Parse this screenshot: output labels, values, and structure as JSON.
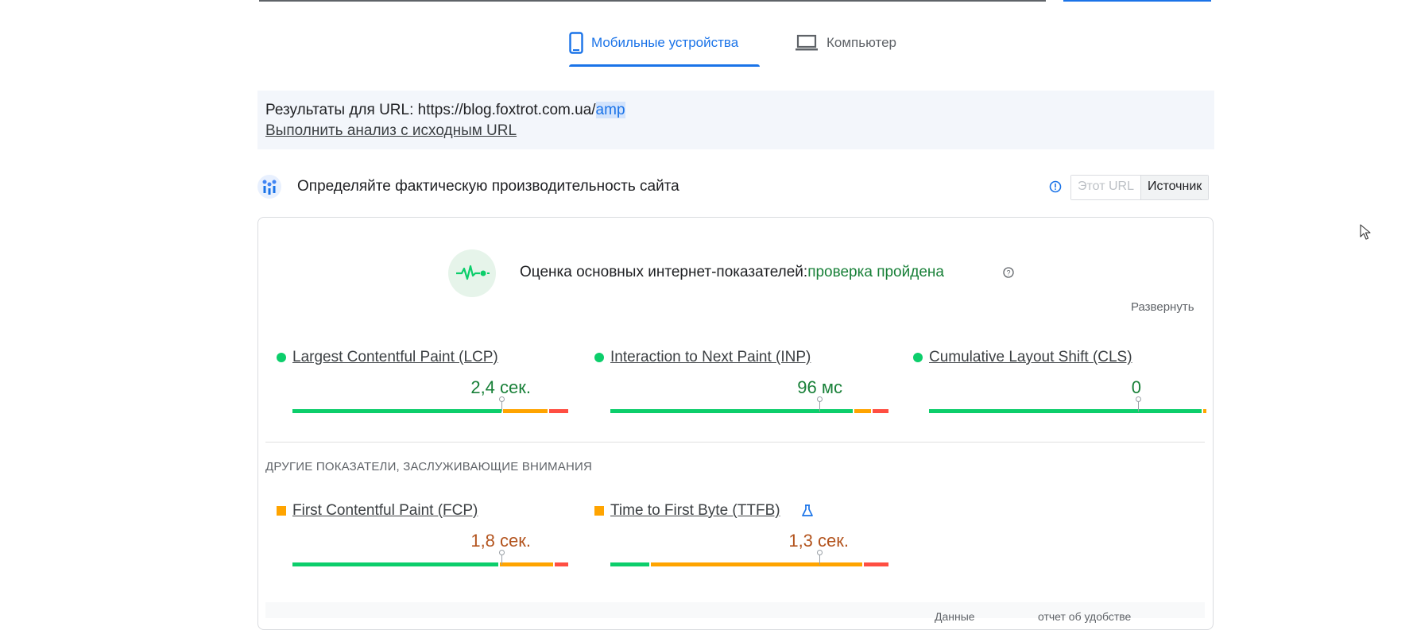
{
  "tabs": {
    "mobile_label": "Мобильные устройства",
    "desktop_label": "Компьютер"
  },
  "url_banner": {
    "prefix": "Результаты для URL: https://blog.foxtrot.com.ua/",
    "highlight": "amp",
    "reanalyze": "Выполнить анализ с исходным URL"
  },
  "section": {
    "title": "Определяйте фактическую производительность сайта",
    "toggle_this_url": "Этот URL",
    "toggle_origin": "Источник"
  },
  "cwv": {
    "title": "Оценка основных интернет-показателей:",
    "status": "проверка пройдена",
    "expand": "Развернуть"
  },
  "metrics": [
    {
      "label": "Largest Contentful Paint (LCP)",
      "value": "2,4 сек.",
      "rating": "good",
      "distribution": {
        "good": 0.75,
        "needs_improvement": 0.16,
        "poor": 0.07
      },
      "marker": 0.75
    },
    {
      "label": "Interaction to Next Paint (INP)",
      "value": "96 мс",
      "rating": "good",
      "distribution": {
        "good": 0.87,
        "needs_improvement": 0.06,
        "poor": 0.07
      },
      "marker": 0.75
    },
    {
      "label": "Cumulative Layout Shift (CLS)",
      "value": "0",
      "rating": "good",
      "distribution": {
        "good": 0.98,
        "needs_improvement": 0.01,
        "poor": 0.01
      },
      "marker": 0.75
    }
  ],
  "other_title": "ДРУГИЕ ПОКАЗАТЕЛИ, ЗАСЛУЖИВАЮЩИЕ ВНИМАНИЯ",
  "other_metrics": [
    {
      "label": "First Contentful Paint (FCP)",
      "value": "1,8 сек.",
      "rating": "needs_improvement",
      "distribution": {
        "good": 0.74,
        "needs_improvement": 0.19,
        "poor": 0.05
      },
      "marker": 0.75
    },
    {
      "label": "Time to First Byte (TTFB)",
      "value": "1,3 сек.",
      "rating": "needs_improvement",
      "distribution": {
        "good": 0.14,
        "needs_improvement": 0.76,
        "poor": 0.09
      },
      "marker": 0.75
    }
  ],
  "bottom": {
    "col1": "Данные",
    "col2": "отчет об удобстве"
  },
  "colors": {
    "accent": "#1a73e8",
    "good": "#0cce6b",
    "needs_improvement": "#ffa400",
    "poor": "#ff4e42",
    "good_text": "#188038",
    "avg_text": "#b3541e"
  }
}
